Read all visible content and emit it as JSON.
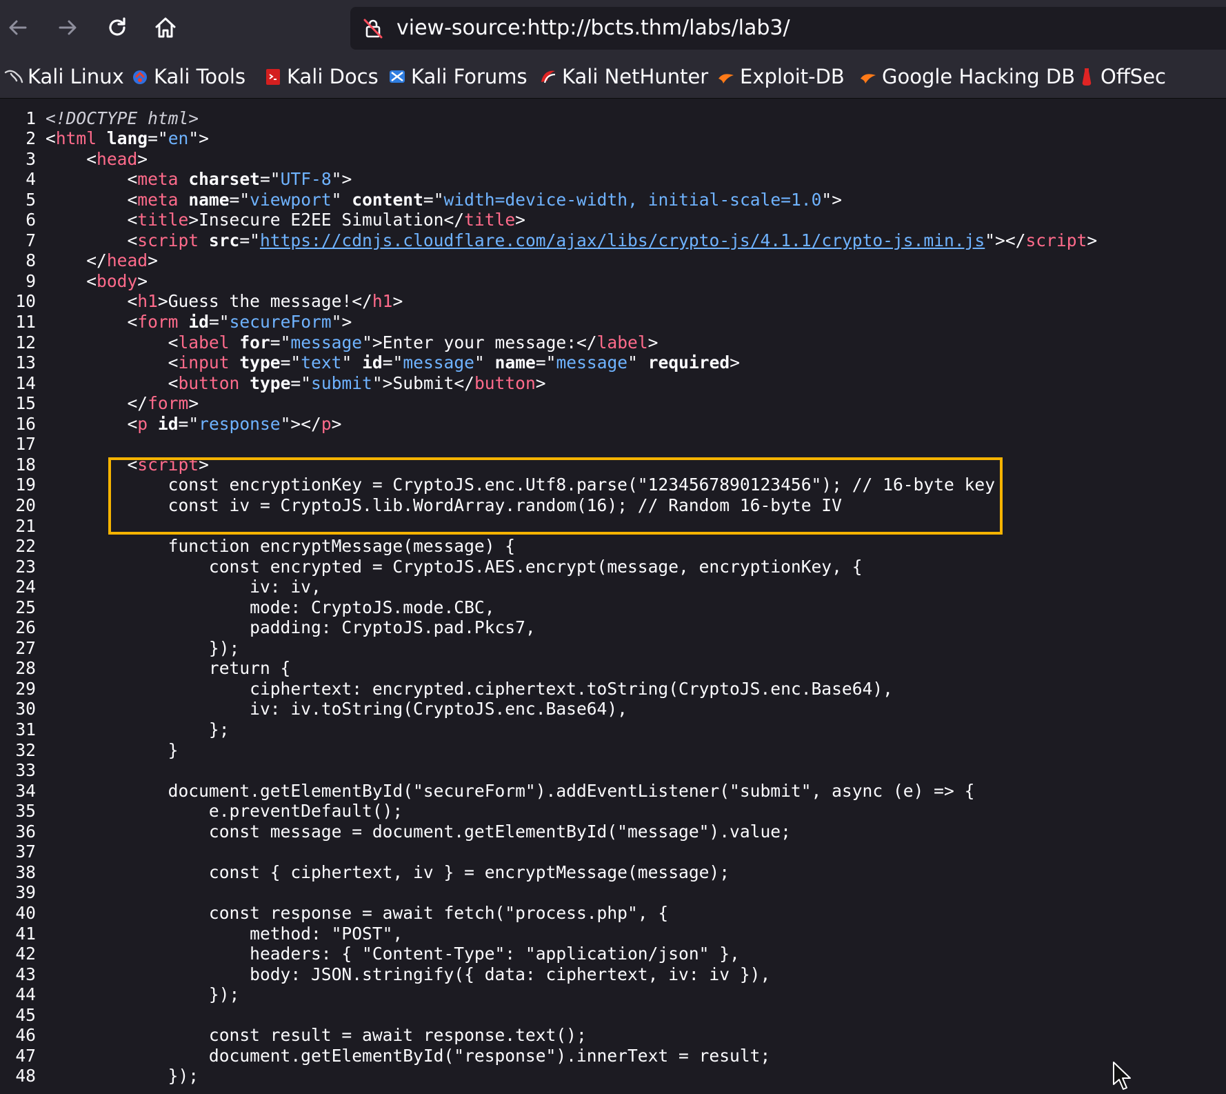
{
  "browser": {
    "url": "view-source:http://bcts.thm/labs/lab3/",
    "nav": {
      "back_icon": "arrow-left-icon",
      "forward_icon": "arrow-right-icon",
      "reload_icon": "reload-icon",
      "home_icon": "home-icon"
    }
  },
  "bookmarks": [
    {
      "label": "Kali Linux",
      "icon": "kali-dragon-icon"
    },
    {
      "label": "Kali Tools",
      "icon": "kali-tools-icon"
    },
    {
      "label": "Kali Docs",
      "icon": "kali-docs-icon"
    },
    {
      "label": "Kali Forums",
      "icon": "kali-forums-icon"
    },
    {
      "label": "Kali NetHunter",
      "icon": "kali-nethunter-icon"
    },
    {
      "label": "Exploit-DB",
      "icon": "exploit-db-icon"
    },
    {
      "label": "Google Hacking DB",
      "icon": "google-hacking-db-icon"
    },
    {
      "label": "OffSec",
      "icon": "offsec-icon"
    }
  ],
  "source_lines": [
    {
      "n": "1",
      "segs": [
        [
          "d",
          "<!DOCTYPE html>"
        ]
      ]
    },
    {
      "n": "2",
      "segs": [
        [
          "p",
          "<"
        ],
        [
          "t",
          "html"
        ],
        [
          "p",
          " "
        ],
        [
          "a",
          "lang"
        ],
        [
          "p",
          "=\""
        ],
        [
          "v",
          "en"
        ],
        [
          "p",
          "\">"
        ]
      ]
    },
    {
      "n": "3",
      "segs": [
        [
          "p",
          "    <"
        ],
        [
          "t",
          "head"
        ],
        [
          "p",
          ">"
        ]
      ]
    },
    {
      "n": "4",
      "segs": [
        [
          "p",
          "        <"
        ],
        [
          "t",
          "meta"
        ],
        [
          "p",
          " "
        ],
        [
          "a",
          "charset"
        ],
        [
          "p",
          "=\""
        ],
        [
          "v",
          "UTF-8"
        ],
        [
          "p",
          "\">"
        ]
      ]
    },
    {
      "n": "5",
      "segs": [
        [
          "p",
          "        <"
        ],
        [
          "t",
          "meta"
        ],
        [
          "p",
          " "
        ],
        [
          "a",
          "name"
        ],
        [
          "p",
          "=\""
        ],
        [
          "v",
          "viewport"
        ],
        [
          "p",
          "\" "
        ],
        [
          "a",
          "content"
        ],
        [
          "p",
          "=\""
        ],
        [
          "v",
          "width=device-width, initial-scale=1.0"
        ],
        [
          "p",
          "\">"
        ]
      ]
    },
    {
      "n": "6",
      "segs": [
        [
          "p",
          "        <"
        ],
        [
          "t",
          "title"
        ],
        [
          "p",
          ">Insecure E2EE Simulation</"
        ],
        [
          "t",
          "title"
        ],
        [
          "p",
          ">"
        ]
      ]
    },
    {
      "n": "7",
      "segs": [
        [
          "p",
          "        <"
        ],
        [
          "t",
          "script"
        ],
        [
          "p",
          " "
        ],
        [
          "a",
          "src"
        ],
        [
          "p",
          "=\""
        ],
        [
          "l",
          "https://cdnjs.cloudflare.com/ajax/libs/crypto-js/4.1.1/crypto-js.min.js"
        ],
        [
          "p",
          "\"></"
        ],
        [
          "t",
          "script"
        ],
        [
          "p",
          ">"
        ]
      ]
    },
    {
      "n": "8",
      "segs": [
        [
          "p",
          "    </"
        ],
        [
          "t",
          "head"
        ],
        [
          "p",
          ">"
        ]
      ]
    },
    {
      "n": "9",
      "segs": [
        [
          "p",
          "    <"
        ],
        [
          "t",
          "body"
        ],
        [
          "p",
          ">"
        ]
      ]
    },
    {
      "n": "10",
      "segs": [
        [
          "p",
          "        <"
        ],
        [
          "t",
          "h1"
        ],
        [
          "p",
          ">Guess the message!</"
        ],
        [
          "t",
          "h1"
        ],
        [
          "p",
          ">"
        ]
      ]
    },
    {
      "n": "11",
      "segs": [
        [
          "p",
          "        <"
        ],
        [
          "t",
          "form"
        ],
        [
          "p",
          " "
        ],
        [
          "a",
          "id"
        ],
        [
          "p",
          "=\""
        ],
        [
          "v",
          "secureForm"
        ],
        [
          "p",
          "\">"
        ]
      ]
    },
    {
      "n": "12",
      "segs": [
        [
          "p",
          "            <"
        ],
        [
          "t",
          "label"
        ],
        [
          "p",
          " "
        ],
        [
          "a",
          "for"
        ],
        [
          "p",
          "=\""
        ],
        [
          "v",
          "message"
        ],
        [
          "p",
          "\">Enter your message:</"
        ],
        [
          "t",
          "label"
        ],
        [
          "p",
          ">"
        ]
      ]
    },
    {
      "n": "13",
      "segs": [
        [
          "p",
          "            <"
        ],
        [
          "t",
          "input"
        ],
        [
          "p",
          " "
        ],
        [
          "a",
          "type"
        ],
        [
          "p",
          "=\""
        ],
        [
          "v",
          "text"
        ],
        [
          "p",
          "\" "
        ],
        [
          "a",
          "id"
        ],
        [
          "p",
          "=\""
        ],
        [
          "v",
          "message"
        ],
        [
          "p",
          "\" "
        ],
        [
          "a",
          "name"
        ],
        [
          "p",
          "=\""
        ],
        [
          "v",
          "message"
        ],
        [
          "p",
          "\" "
        ],
        [
          "a",
          "required"
        ],
        [
          "p",
          ">"
        ]
      ]
    },
    {
      "n": "14",
      "segs": [
        [
          "p",
          "            <"
        ],
        [
          "t",
          "button"
        ],
        [
          "p",
          " "
        ],
        [
          "a",
          "type"
        ],
        [
          "p",
          "=\""
        ],
        [
          "v",
          "submit"
        ],
        [
          "p",
          "\">Submit</"
        ],
        [
          "t",
          "button"
        ],
        [
          "p",
          ">"
        ]
      ]
    },
    {
      "n": "15",
      "segs": [
        [
          "p",
          "        </"
        ],
        [
          "t",
          "form"
        ],
        [
          "p",
          ">"
        ]
      ]
    },
    {
      "n": "16",
      "segs": [
        [
          "p",
          "        <"
        ],
        [
          "t",
          "p"
        ],
        [
          "p",
          " "
        ],
        [
          "a",
          "id"
        ],
        [
          "p",
          "=\""
        ],
        [
          "v",
          "response"
        ],
        [
          "p",
          "\"></"
        ],
        [
          "t",
          "p"
        ],
        [
          "p",
          ">"
        ]
      ]
    },
    {
      "n": "17",
      "segs": []
    },
    {
      "n": "18",
      "segs": [
        [
          "p",
          "        <"
        ],
        [
          "t",
          "script"
        ],
        [
          "p",
          ">"
        ]
      ]
    },
    {
      "n": "19",
      "segs": [
        [
          "p",
          "            const encryptionKey = CryptoJS.enc.Utf8.parse(\"1234567890123456\"); // 16-byte key"
        ]
      ]
    },
    {
      "n": "20",
      "segs": [
        [
          "p",
          "            const iv = CryptoJS.lib.WordArray.random(16); // Random 16-byte IV"
        ]
      ]
    },
    {
      "n": "21",
      "segs": []
    },
    {
      "n": "22",
      "segs": [
        [
          "p",
          "            function encryptMessage(message) {"
        ]
      ]
    },
    {
      "n": "23",
      "segs": [
        [
          "p",
          "                const encrypted = CryptoJS.AES.encrypt(message, encryptionKey, {"
        ]
      ]
    },
    {
      "n": "24",
      "segs": [
        [
          "p",
          "                    iv: iv,"
        ]
      ]
    },
    {
      "n": "25",
      "segs": [
        [
          "p",
          "                    mode: CryptoJS.mode.CBC,"
        ]
      ]
    },
    {
      "n": "26",
      "segs": [
        [
          "p",
          "                    padding: CryptoJS.pad.Pkcs7,"
        ]
      ]
    },
    {
      "n": "27",
      "segs": [
        [
          "p",
          "                });"
        ]
      ]
    },
    {
      "n": "28",
      "segs": [
        [
          "p",
          "                return {"
        ]
      ]
    },
    {
      "n": "29",
      "segs": [
        [
          "p",
          "                    ciphertext: encrypted.ciphertext.toString(CryptoJS.enc.Base64),"
        ]
      ]
    },
    {
      "n": "30",
      "segs": [
        [
          "p",
          "                    iv: iv.toString(CryptoJS.enc.Base64),"
        ]
      ]
    },
    {
      "n": "31",
      "segs": [
        [
          "p",
          "                };"
        ]
      ]
    },
    {
      "n": "32",
      "segs": [
        [
          "p",
          "            }"
        ]
      ]
    },
    {
      "n": "33",
      "segs": []
    },
    {
      "n": "34",
      "segs": [
        [
          "p",
          "            document.getElementById(\"secureForm\").addEventListener(\"submit\", async (e) => {"
        ]
      ]
    },
    {
      "n": "35",
      "segs": [
        [
          "p",
          "                e.preventDefault();"
        ]
      ]
    },
    {
      "n": "36",
      "segs": [
        [
          "p",
          "                const message = document.getElementById(\"message\").value;"
        ]
      ]
    },
    {
      "n": "37",
      "segs": []
    },
    {
      "n": "38",
      "segs": [
        [
          "p",
          "                const { ciphertext, iv } = encryptMessage(message);"
        ]
      ]
    },
    {
      "n": "39",
      "segs": []
    },
    {
      "n": "40",
      "segs": [
        [
          "p",
          "                const response = await fetch(\"process.php\", {"
        ]
      ]
    },
    {
      "n": "41",
      "segs": [
        [
          "p",
          "                    method: \"POST\","
        ]
      ]
    },
    {
      "n": "42",
      "segs": [
        [
          "p",
          "                    headers: { \"Content-Type\": \"application/json\" },"
        ]
      ]
    },
    {
      "n": "43",
      "segs": [
        [
          "p",
          "                    body: JSON.stringify({ data: ciphertext, iv: iv }),"
        ]
      ]
    },
    {
      "n": "44",
      "segs": [
        [
          "p",
          "                });"
        ]
      ]
    },
    {
      "n": "45",
      "segs": []
    },
    {
      "n": "46",
      "segs": [
        [
          "p",
          "                const result = await response.text();"
        ]
      ]
    },
    {
      "n": "47",
      "segs": [
        [
          "p",
          "                document.getElementById(\"response\").innerText = result;"
        ]
      ]
    },
    {
      "n": "48",
      "segs": [
        [
          "p",
          "            });"
        ]
      ]
    }
  ],
  "colors": {
    "highlight_box": "#f5b301",
    "tag": "#ff6b8b",
    "attr_value": "#6fb3ff",
    "background": "#1c1b22",
    "toolbar": "#2b2a33"
  }
}
